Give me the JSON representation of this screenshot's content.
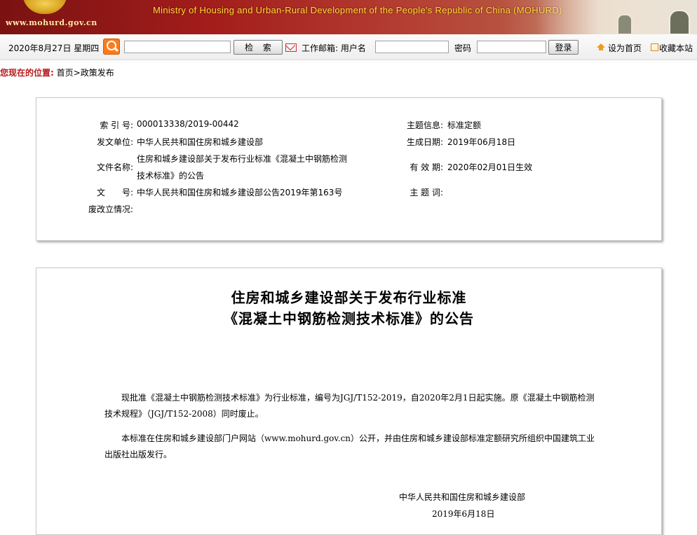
{
  "banner": {
    "site_url": "www.mohurd.gov.cn",
    "ministry_name": "Ministry of Housing and Urban-Rural Development of the People's Republic of China (MOHURD)"
  },
  "toolbar": {
    "date": "2020年8月27日 星期四",
    "search_value": "",
    "search_button": "检 索",
    "mail_label": "工作邮箱: 用户名",
    "username_value": "",
    "password_label": "密码",
    "password_value": "",
    "login_button": "登录",
    "set_home": "设为首页",
    "favorite": "收藏本站"
  },
  "breadcrumb": {
    "lead": "您现在的位置:",
    "home": "首页",
    "separator": ">",
    "current": "政策发布"
  },
  "info": {
    "index_label": "索 引 号:",
    "index_value": "000013338/2019-00442",
    "issuer_label": "发文单位:",
    "issuer_value": "中华人民共和国住房和城乡建设部",
    "filename_label": "文件名称:",
    "filename_line1": "住房和城乡建设部关于发布行业标准《混凝土中钢筋检测",
    "filename_line2": "技术标准》的公告",
    "docno_label": "文　　号:",
    "docno_value": "中华人民共和国住房和城乡建设部公告2019年第163号",
    "abolish_label": "废改立情况:",
    "abolish_value": "",
    "topic_label": "主题信息:",
    "topic_value": "标准定额",
    "created_label": "生成日期:",
    "created_value": "2019年06月18日",
    "valid_label": "有 效 期:",
    "valid_value": "2020年02月01日生效",
    "keywords_label": "主 题 词:",
    "keywords_value": ""
  },
  "document": {
    "title_line1": "住房和城乡建设部关于发布行业标准",
    "title_line2": "《混凝土中钢筋检测技术标准》的公告",
    "paragraph1": "现批准《混凝土中钢筋检测技术标准》为行业标准，编号为JGJ/T152-2019，自2020年2月1日起实施。原《混凝土中钢筋检测技术规程》（JGJ/T152-2008）同时废止。",
    "paragraph2": "本标准在住房和城乡建设部门户网站（www.mohurd.gov.cn）公开，并由住房和城乡建设部标准定额研究所组织中国建筑工业出版社出版发行。",
    "signer": "中华人民共和国住房和城乡建设部",
    "sign_date": "2019年6月18日"
  }
}
